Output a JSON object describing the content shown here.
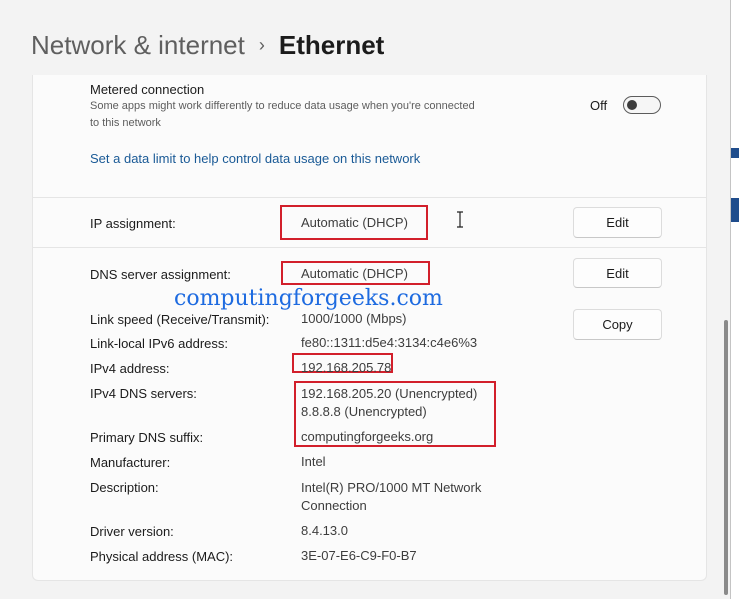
{
  "breadcrumb": {
    "parent": "Network & internet",
    "separator": "›",
    "current": "Ethernet"
  },
  "metered": {
    "title": "Metered connection",
    "description": "Some apps might work differently to reduce data usage when you're connected to this network",
    "toggle_state": "Off",
    "toggle_on": false,
    "data_limit_link": "Set a data limit to help control data usage on this network"
  },
  "ip_assignment": {
    "label": "IP assignment:",
    "value": "Automatic (DHCP)",
    "button": "Edit"
  },
  "dns_assignment": {
    "label": "DNS server assignment:",
    "value": "Automatic (DHCP)",
    "button": "Edit"
  },
  "watermark": "computingforgeeks.com",
  "copy_button": "Copy",
  "properties": [
    {
      "label": "Link speed (Receive/Transmit):",
      "values": [
        "1000/1000 (Mbps)"
      ]
    },
    {
      "label": "Link-local IPv6 address:",
      "values": [
        "fe80::1311:d5e4:3134:c4e6%3"
      ]
    },
    {
      "label": "IPv4 address:",
      "values": [
        "192.168.205.78"
      ]
    },
    {
      "label": "IPv4 DNS servers:",
      "values": [
        "192.168.205.20 (Unencrypted)",
        "8.8.8.8 (Unencrypted)"
      ]
    },
    {
      "label": "Primary DNS suffix:",
      "values": [
        "computingforgeeks.org"
      ]
    },
    {
      "label": "Manufacturer:",
      "values": [
        "Intel"
      ]
    },
    {
      "label": "Description:",
      "values": [
        "Intel(R) PRO/1000 MT Network",
        "Connection"
      ]
    },
    {
      "label": "Driver version:",
      "values": [
        "8.4.13.0"
      ]
    },
    {
      "label": "Physical address (MAC):",
      "values": [
        "3E-07-E6-C9-F0-B7"
      ]
    }
  ],
  "colors": {
    "highlight_box": "#d21f2b",
    "link": "#1a5a96",
    "watermark": "#1e6be0",
    "page_background": "#f3f3f3",
    "card_background": "#fbfbfb"
  },
  "icons": {
    "breadcrumb_separator": "chevron-right-icon",
    "text_cursor": "i-beam-cursor-icon"
  }
}
